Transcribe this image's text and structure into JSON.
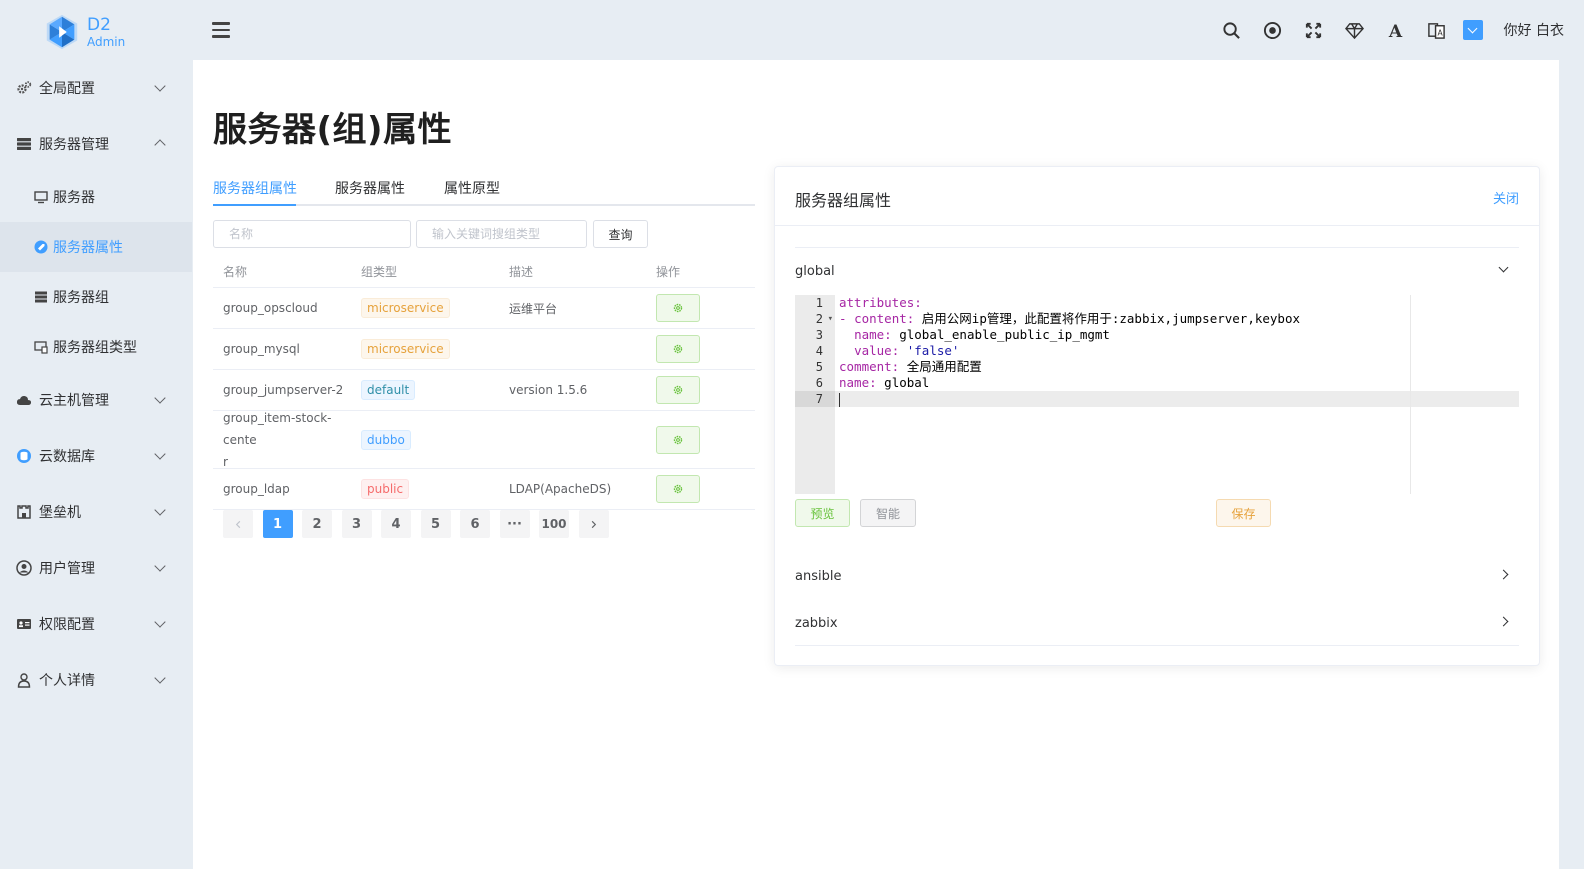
{
  "logo": {
    "title": "D2",
    "subtitle": "Admin"
  },
  "header": {
    "greeting": "你好 白衣",
    "icons": [
      "search-icon",
      "target-icon",
      "fullscreen-icon",
      "diamond-icon",
      "font-icon",
      "translate-icon",
      "theme-icon"
    ],
    "accent": "#409eff"
  },
  "sidebar": {
    "items": [
      {
        "label": "全局配置",
        "icon": "gears-icon",
        "expanded": false
      },
      {
        "label": "服务器管理",
        "icon": "server-icon",
        "expanded": true,
        "children": [
          {
            "label": "服务器",
            "icon": "monitor-icon"
          },
          {
            "label": "服务器属性",
            "icon": "tag-icon",
            "active": true
          },
          {
            "label": "服务器组",
            "icon": "server-stack-icon"
          },
          {
            "label": "服务器组类型",
            "icon": "desktop-icon"
          }
        ]
      },
      {
        "label": "云主机管理",
        "icon": "cloud-icon",
        "expanded": false
      },
      {
        "label": "云数据库",
        "icon": "database-icon",
        "expanded": false
      },
      {
        "label": "堡垒机",
        "icon": "fortress-icon",
        "expanded": false
      },
      {
        "label": "用户管理",
        "icon": "user-circle-icon",
        "expanded": false
      },
      {
        "label": "权限配置",
        "icon": "id-card-icon",
        "expanded": false
      },
      {
        "label": "个人详情",
        "icon": "user-icon",
        "expanded": false
      }
    ]
  },
  "page": {
    "title": "服务器(组)属性"
  },
  "tabs": [
    {
      "label": "服务器组属性",
      "active": true
    },
    {
      "label": "服务器属性",
      "active": false
    },
    {
      "label": "属性原型",
      "active": false
    }
  ],
  "filters": {
    "name_placeholder": "名称",
    "type_placeholder": "输入关键词搜组类型",
    "query_label": "查询"
  },
  "table": {
    "columns": [
      "名称",
      "组类型",
      "描述",
      "操作"
    ],
    "rows": [
      {
        "name": "group_opscloud",
        "type": "microservice",
        "type_style": "warn",
        "desc": "运维平台"
      },
      {
        "name": "group_mysql",
        "type": "microservice",
        "type_style": "warn",
        "desc": ""
      },
      {
        "name": "group_jumpserver-2",
        "type": "default",
        "type_style": "teal",
        "desc": "version 1.5.6"
      },
      {
        "name": "group_item-stock-cente",
        "name_wrap": "r",
        "type": "dubbo",
        "type_style": "info",
        "desc": ""
      },
      {
        "name": "group_ldap",
        "type": "public",
        "type_style": "danger",
        "desc": "LDAP(ApacheDS)"
      }
    ]
  },
  "pagination": {
    "pages": [
      "1",
      "2",
      "3",
      "4",
      "5",
      "6",
      "···",
      "100"
    ],
    "current": "1"
  },
  "card": {
    "title": "服务器组属性",
    "close_label": "关闭",
    "sections": [
      {
        "label": "global",
        "expanded": true
      },
      {
        "label": "ansible",
        "expanded": false
      },
      {
        "label": "zabbix",
        "expanded": false
      }
    ],
    "editor": {
      "line_numbers": [
        "1",
        "2",
        "3",
        "4",
        "5",
        "6",
        "7"
      ],
      "lines": [
        "attributes:",
        "- content: 启用公网ip管理，此配置将作用于:zabbix,jumpserver,keybox",
        "  name: global_enable_public_ip_mgmt",
        "  value: 'false'",
        "comment: 全局通用配置",
        "name: global",
        ""
      ]
    },
    "buttons": {
      "preview": "预览",
      "smart": "智能",
      "save": "保存"
    }
  }
}
